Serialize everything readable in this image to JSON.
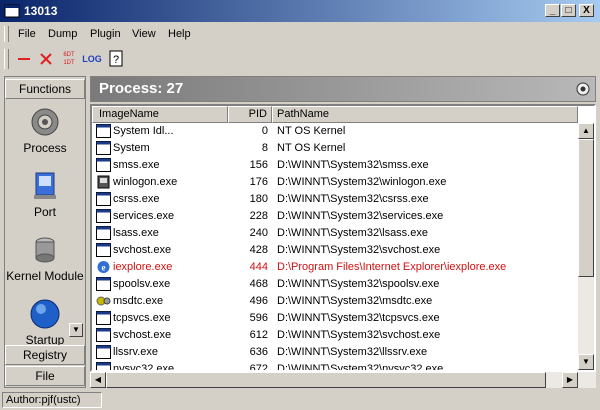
{
  "window": {
    "title": "13013",
    "controls": [
      "_",
      "□",
      "X"
    ]
  },
  "menu": [
    "File",
    "Dump",
    "Plugin",
    "View",
    "Help"
  ],
  "toolbar": {
    "log_label": "LOG",
    "hex_label": "6DT\n1DT",
    "help_label": "?"
  },
  "sidebar": {
    "functions_label": "Functions",
    "tools": [
      {
        "label": "Process",
        "icon": "gear-icon"
      },
      {
        "label": "Port",
        "icon": "network-icon"
      },
      {
        "label": "Kernel Module",
        "icon": "disk-icon"
      },
      {
        "label": "Startup",
        "icon": "globe-icon"
      }
    ],
    "registry_label": "Registry",
    "file_label": "File"
  },
  "process_panel": {
    "title": "Process: 27"
  },
  "table": {
    "columns": [
      "ImageName",
      "PID",
      "PathName"
    ],
    "rows": [
      {
        "name": "System Idl...",
        "pid": "0",
        "path": "NT OS Kernel",
        "icon": "window"
      },
      {
        "name": "System",
        "pid": "8",
        "path": "NT OS Kernel",
        "icon": "window"
      },
      {
        "name": "smss.exe",
        "pid": "156",
        "path": "D:\\WINNT\\System32\\smss.exe",
        "icon": "window"
      },
      {
        "name": "winlogon.exe",
        "pid": "176",
        "path": "D:\\WINNT\\System32\\winlogon.exe",
        "icon": "winlogon"
      },
      {
        "name": "csrss.exe",
        "pid": "180",
        "path": "D:\\WINNT\\System32\\csrss.exe",
        "icon": "window"
      },
      {
        "name": "services.exe",
        "pid": "228",
        "path": "D:\\WINNT\\System32\\services.exe",
        "icon": "window"
      },
      {
        "name": "lsass.exe",
        "pid": "240",
        "path": "D:\\WINNT\\System32\\lsass.exe",
        "icon": "window"
      },
      {
        "name": "svchost.exe",
        "pid": "428",
        "path": "D:\\WINNT\\System32\\svchost.exe",
        "icon": "window"
      },
      {
        "name": "iexplore.exe",
        "pid": "444",
        "path": "D:\\Program Files\\Internet Explorer\\iexplore.exe",
        "icon": "ie",
        "highlight": true
      },
      {
        "name": "spoolsv.exe",
        "pid": "468",
        "path": "D:\\WINNT\\System32\\spoolsv.exe",
        "icon": "window"
      },
      {
        "name": "msdtc.exe",
        "pid": "496",
        "path": "D:\\WINNT\\System32\\msdtc.exe",
        "icon": "msdtc"
      },
      {
        "name": "tcpsvcs.exe",
        "pid": "596",
        "path": "D:\\WINNT\\System32\\tcpsvcs.exe",
        "icon": "window"
      },
      {
        "name": "svchost.exe",
        "pid": "612",
        "path": "D:\\WINNT\\System32\\svchost.exe",
        "icon": "window"
      },
      {
        "name": "llssrv.exe",
        "pid": "636",
        "path": "D:\\WINNT\\System32\\llssrv.exe",
        "icon": "window"
      },
      {
        "name": "nvsvc32.exe",
        "pid": "672",
        "path": "D:\\WINNT\\System32\\nvsvc32.exe",
        "icon": "window"
      }
    ]
  },
  "status": {
    "author": "Author:pjf(ustc)"
  },
  "colors": {
    "titlebar_start": "#0a246a",
    "titlebar_end": "#a6caf0",
    "highlight_text": "#d01010",
    "process_header": "#7a7a7a"
  }
}
